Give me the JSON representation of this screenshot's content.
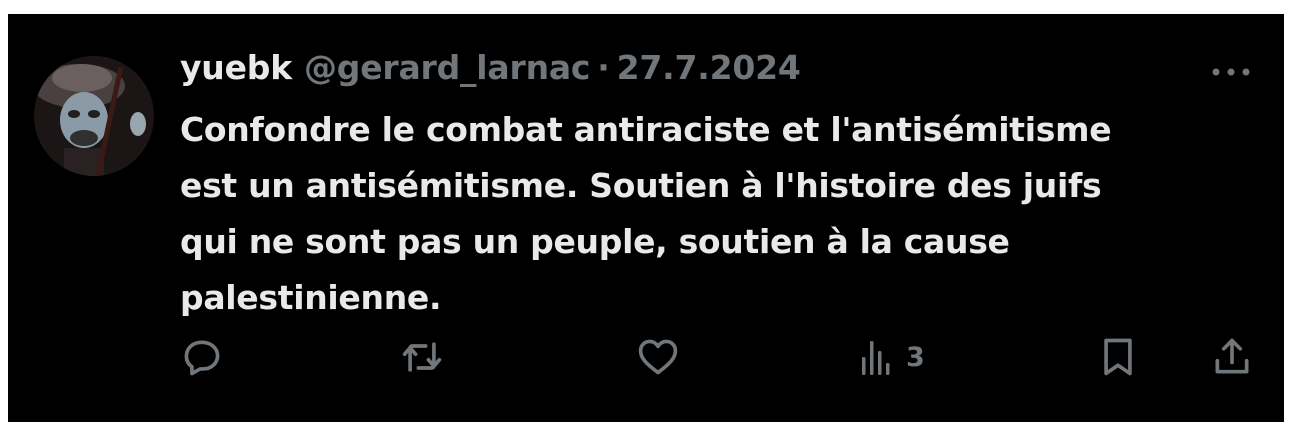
{
  "tweet": {
    "display_name": "yuebk",
    "handle": "@gerard_larnac",
    "separator": "·",
    "date": "27.7.2024",
    "text": "Confondre le combat antiraciste et l'antisémitisme\nest un antisémitisme. Soutien à l'histoire des juifs\nqui ne sont pas un peuple, soutien à la cause\npalestinienne.",
    "views": "3"
  },
  "icons": {
    "avatar": "avatar-image",
    "more": "more-dots-icon",
    "reply": "reply-icon",
    "repost": "repost-icon",
    "like": "heart-icon",
    "views": "views-bar-chart-icon",
    "bookmark": "bookmark-icon",
    "share": "share-icon"
  },
  "colors": {
    "background": "#000000",
    "primary_text": "#e7e9ea",
    "secondary_text": "#71767b"
  }
}
